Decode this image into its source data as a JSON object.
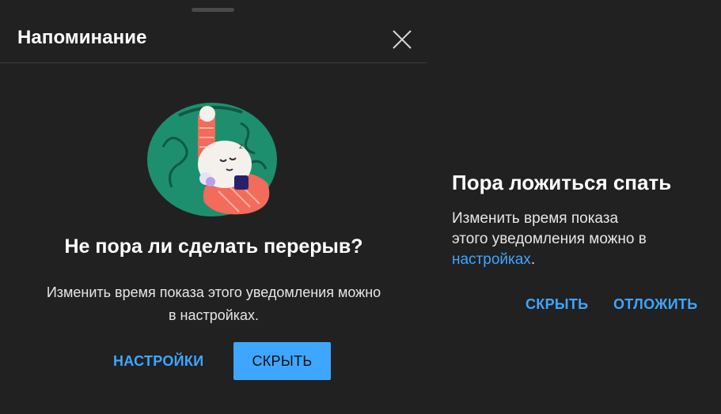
{
  "sheet": {
    "title": "Напоминание",
    "heading": "Не пора ли сделать перерыв?",
    "body_line1": "Изменить время показа этого уведомления можно",
    "body_line2": "в настройках.",
    "settings_label": "НАСТРОЙКИ",
    "hide_label": "СКРЫТЬ",
    "illustration_icon": "sleeping-character-illustration"
  },
  "dialog": {
    "title": "Пора ложиться спать",
    "body_line1": "Изменить время показа",
    "body_line2": "этого уведомления можно в",
    "link_text": "настройках",
    "link_suffix": ".",
    "hide_label": "СКРЫТЬ",
    "snooze_label": "ОТЛОЖИТЬ"
  },
  "colors": {
    "background": "#212121",
    "accent": "#3ea6ff",
    "illustration_green": "#1e8f6e",
    "illustration_coral": "#f26b5b"
  }
}
